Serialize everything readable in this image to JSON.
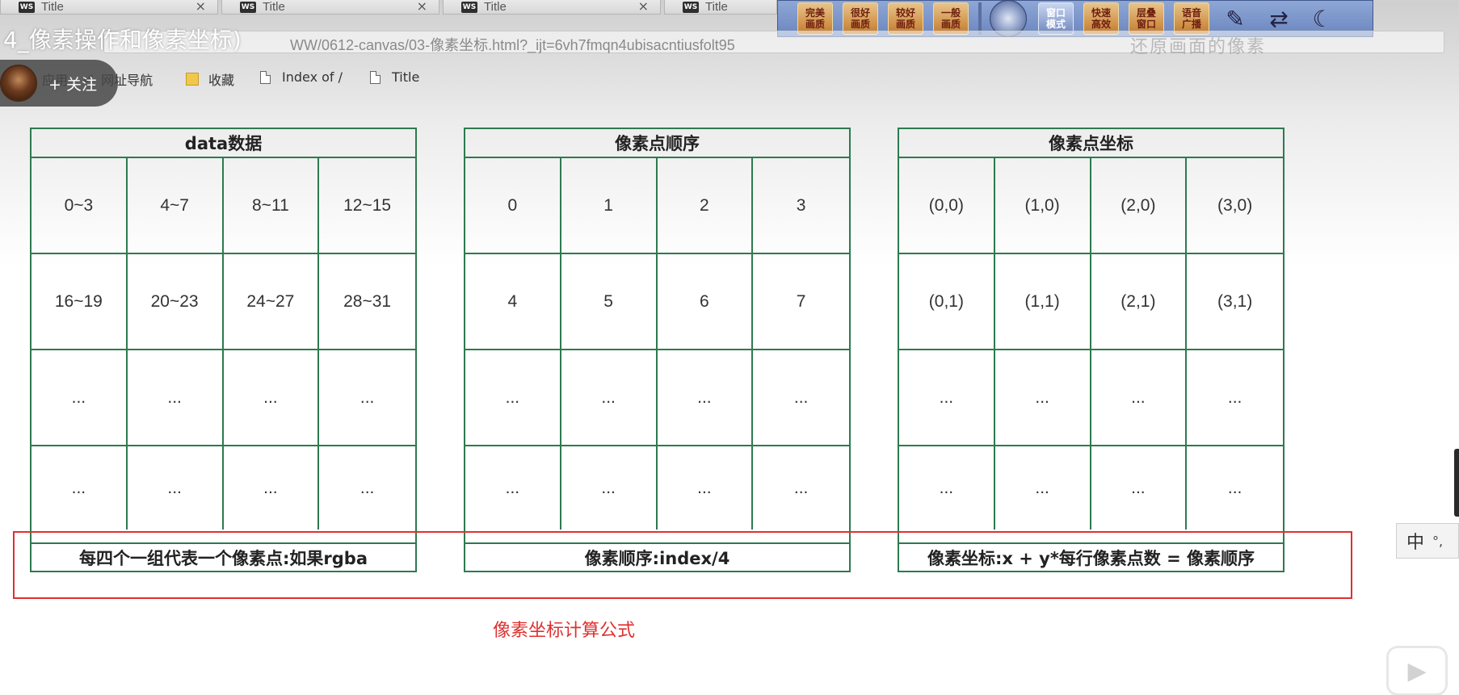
{
  "tabs": [
    {
      "badge": "WS",
      "title": "Title",
      "close": "×"
    },
    {
      "badge": "WS",
      "title": "Title",
      "close": "×"
    },
    {
      "badge": "WS",
      "title": "Title",
      "close": "×"
    },
    {
      "badge": "WS",
      "title": "Title",
      "close": ""
    }
  ],
  "video_title": "4_像素操作和像素坐标)",
  "address_bar": {
    "url": "WW/0612-canvas/03-像素坐标.html?_ijt=6vh7fmqn4ubisacntiusfolt95",
    "watermark": "还原画面的像素"
  },
  "bookmarks": [
    {
      "label": "应用"
    },
    {
      "label": "网址导航"
    },
    {
      "label": "收藏"
    },
    {
      "label": "Index of /"
    },
    {
      "label": "Title"
    }
  ],
  "follow": {
    "label": "+ 关注"
  },
  "player_toolbar": {
    "buttons": [
      {
        "line1": "完美",
        "line2": "画质"
      },
      {
        "line1": "很好",
        "line2": "画质"
      },
      {
        "line1": "较好",
        "line2": "画质"
      },
      {
        "line1": "一般",
        "line2": "画质"
      },
      {
        "line1": "窗口",
        "line2": "模式"
      },
      {
        "line1": "快速",
        "line2": "高效"
      },
      {
        "line1": "层叠",
        "line2": "窗口"
      },
      {
        "line1": "语音",
        "line2": "广播"
      }
    ]
  },
  "tables": [
    {
      "header": "data数据",
      "rows": [
        [
          "0~3",
          "4~7",
          "8~11",
          "12~15"
        ],
        [
          "16~19",
          "20~23",
          "24~27",
          "28~31"
        ],
        [
          "...",
          "...",
          "...",
          "..."
        ],
        [
          "...",
          "...",
          "...",
          "..."
        ]
      ],
      "footer": "每四个一组代表一个像素点:如果rgba"
    },
    {
      "header": "像素点顺序",
      "rows": [
        [
          "0",
          "1",
          "2",
          "3"
        ],
        [
          "4",
          "5",
          "6",
          "7"
        ],
        [
          "...",
          "...",
          "...",
          "..."
        ],
        [
          "...",
          "...",
          "...",
          "..."
        ]
      ],
      "footer": "像素顺序:index/4"
    },
    {
      "header": "像素点坐标",
      "rows": [
        [
          "(0,0)",
          "(1,0)",
          "(2,0)",
          "(3,0)"
        ],
        [
          "(0,1)",
          "(1,1)",
          "(2,1)",
          "(3,1)"
        ],
        [
          "...",
          "...",
          "...",
          "..."
        ],
        [
          "...",
          "...",
          "...",
          "..."
        ]
      ],
      "footer": "像素坐标:x + y*每行像素点数 = 像素顺序"
    }
  ],
  "annotation": {
    "caption": "像素坐标计算公式",
    "color": "#e03030"
  },
  "ime": {
    "label": "中",
    "dots": "°,"
  },
  "colors": {
    "table_border": "#2d7a4f",
    "annotation": "#e03030"
  }
}
